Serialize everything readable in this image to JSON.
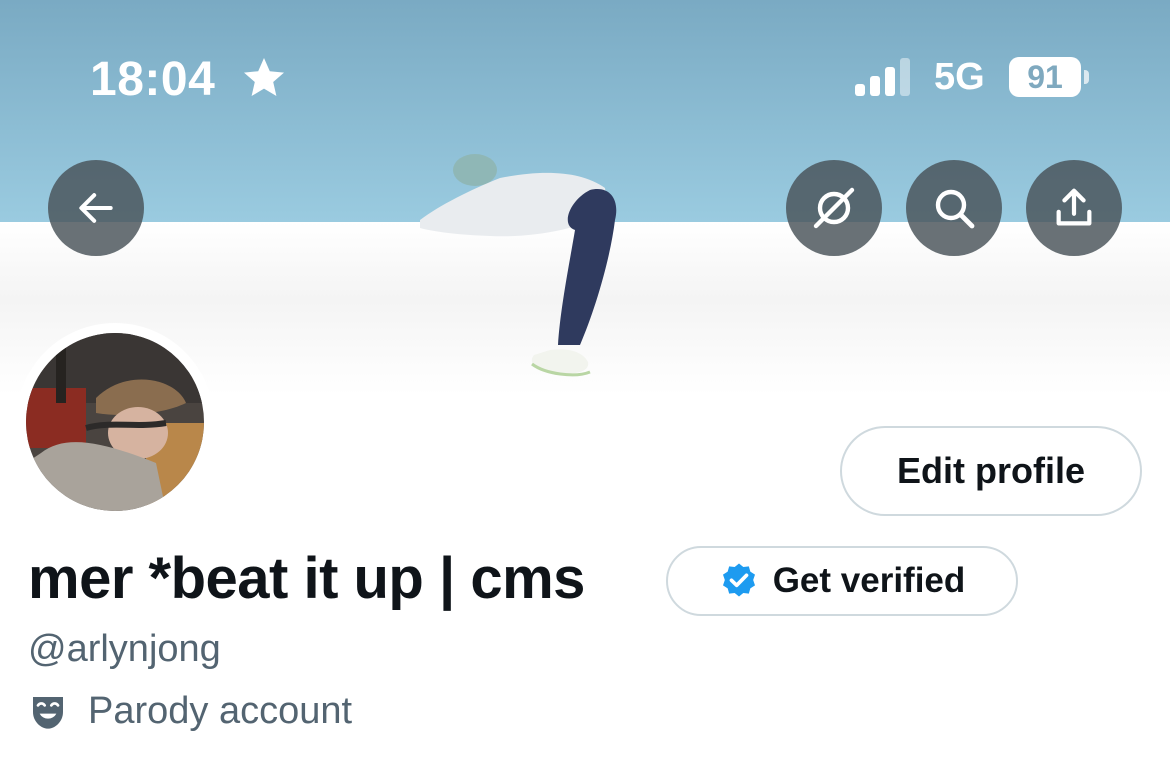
{
  "status_bar": {
    "time": "18:04",
    "network": "5G",
    "battery": "91",
    "icons": [
      "star-icon",
      "cellular-signal-icon",
      "battery-icon"
    ]
  },
  "header_buttons": {
    "back": "back-arrow-icon",
    "grok": "grok-icon",
    "search": "search-icon",
    "share": "share-icon"
  },
  "profile": {
    "edit_profile_label": "Edit profile",
    "display_name": "mer *beat it up | cms",
    "get_verified_label": "Get verified",
    "handle": "@arlynjong",
    "parody_label": "Parody account"
  },
  "colors": {
    "banner_sky": "#8fbdd4",
    "text_primary": "#0f1419",
    "text_secondary": "#536471",
    "verified_blue": "#1d9bf0",
    "button_border": "#cfd9de"
  }
}
